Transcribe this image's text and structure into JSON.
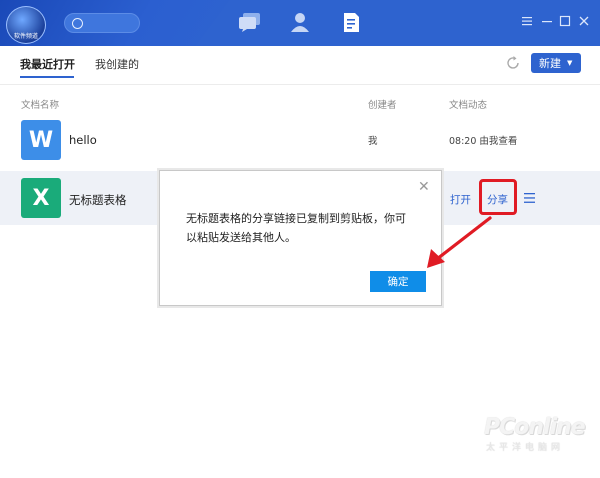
{
  "titlebar": {
    "logo_text": "软件频道",
    "search": {
      "placeholder": ""
    }
  },
  "tabs": [
    {
      "label": "我最近打开",
      "active": true
    },
    {
      "label": "我创建的",
      "active": false
    }
  ],
  "toolbar": {
    "new_label": "新建"
  },
  "columns": {
    "name": "文档名称",
    "creator": "创建者",
    "activity": "文档动态"
  },
  "files": [
    {
      "icon_letter": "W",
      "icon_color": "#3d8ee8",
      "name": "hello",
      "creator": "我",
      "activity": "08:20 由我查看"
    },
    {
      "icon_letter": "X",
      "icon_color": "#1aab7a",
      "name": "无标题表格",
      "actions": {
        "open": "打开",
        "share": "分享"
      }
    }
  ],
  "dialog": {
    "message": "无标题表格的分享链接已复制到剪贴板，你可以粘贴发送给其他人。",
    "ok_label": "确定"
  },
  "watermark": {
    "main": "PConline",
    "sub": "太平洋电脑网"
  },
  "colors": {
    "accent": "#2e63cf",
    "ok_button": "#0f8de8",
    "highlight": "#e01b24"
  }
}
